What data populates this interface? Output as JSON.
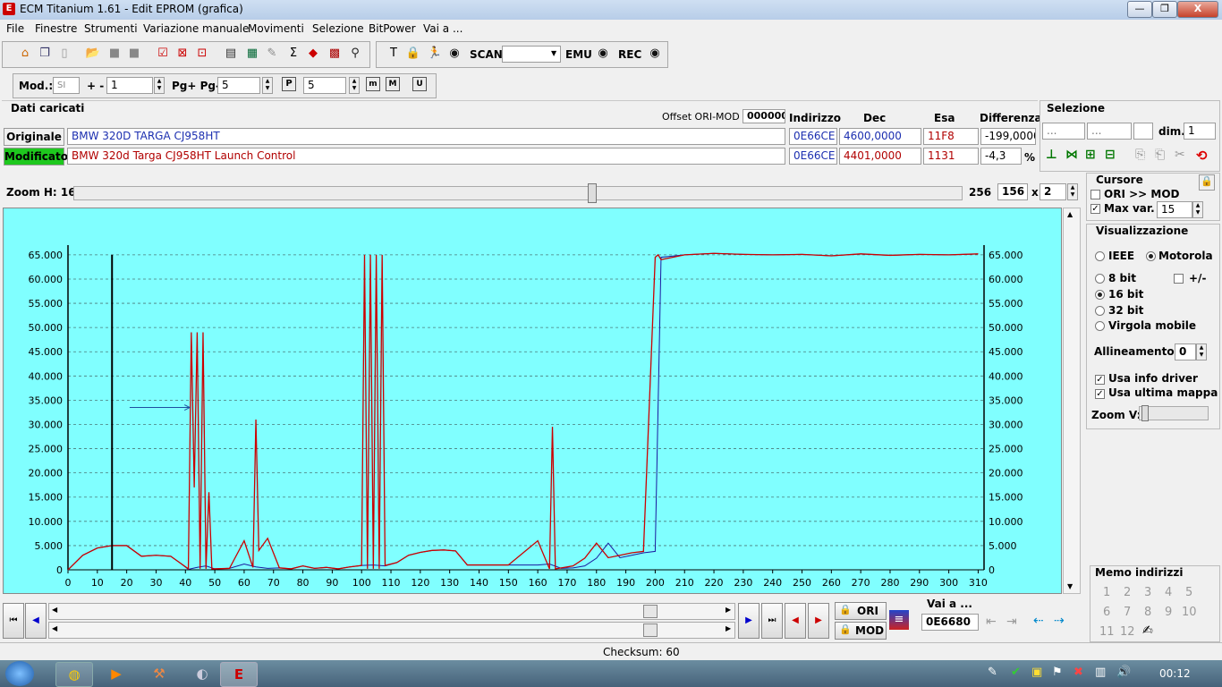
{
  "window": {
    "title": "ECM Titanium 1.61 - Edit EPROM (grafica)",
    "min": "—",
    "max": "❐",
    "close": "X"
  },
  "menu": [
    "File",
    "Finestre",
    "Strumenti",
    "Variazione manuale",
    "Movimenti",
    "Selezione",
    "BitPower",
    "Vai a ..."
  ],
  "toolbar": {
    "scan_label": "SCAN",
    "emu_label": "EMU",
    "rec_label": "REC"
  },
  "toolbar2": {
    "mod_label": "Mod.:",
    "mod_value": "SI",
    "step_label": "+ -",
    "step_value": "1",
    "pg_label": "Pg+ Pg-",
    "pg_value": "5",
    "p_value": "5"
  },
  "data": {
    "section_title": "Dati caricati",
    "offset_label": "Offset ORI-MOD",
    "offset_value": "000000",
    "col_indirizzo": "Indirizzo",
    "col_dec": "Dec",
    "col_esa": "Esa",
    "col_diff": "Differenza",
    "orig_label": "Originale",
    "orig_name": "BMW 320D TARGA CJ958HT",
    "orig_addr": "0E66CE",
    "orig_dec": "4600,0000",
    "orig_esa": "11F8",
    "orig_diff": "-199,0000",
    "mod_label": "Modificato",
    "mod_name": "BMW 320d Targa CJ958HT Launch Control",
    "mod_addr": "0E66CE",
    "mod_dec": "4401,0000",
    "mod_esa": "1131",
    "mod_diff": "-4,3",
    "pct": "%"
  },
  "selezione": {
    "title": "Selezione",
    "f1": "...",
    "f2": "...",
    "dim_label": "dim.",
    "dim_value": "1"
  },
  "zoom": {
    "label": "Zoom H: 16",
    "right": "256",
    "w": "156",
    "x": "x",
    "h": "2"
  },
  "cursore": {
    "title": "Cursore",
    "ori_mod": "ORI >> MOD",
    "max_var": "Max var.",
    "max_var_value": "15"
  },
  "visual": {
    "title": "Visualizzazione",
    "ieee": "IEEE",
    "motorola": "Motorola",
    "b8": "8 bit",
    "pm": "+/-",
    "b16": "16 bit",
    "b32": "32 bit",
    "float": "Virgola mobile",
    "align_label": "Allineamento:",
    "align_value": "0",
    "info_driver": "Usa info driver",
    "last_map": "Usa ultima mappa",
    "zoomv": "Zoom V:"
  },
  "memo": {
    "title": "Memo indirizzi",
    "nums": [
      "1",
      "2",
      "3",
      "4",
      "5",
      "6",
      "7",
      "8",
      "9",
      "10",
      "11",
      "12"
    ]
  },
  "bottom": {
    "ori": "ORI",
    "mod": "MOD",
    "vai_label": "Vai a ...",
    "vai_value": "0E6680",
    "checksum": "Checksum: 60"
  },
  "taskbar": {
    "time": "00:12"
  },
  "chart_data": {
    "type": "line",
    "xlim": [
      0,
      312
    ],
    "ylim": [
      0,
      65535
    ],
    "xticks": [
      0,
      10,
      20,
      30,
      40,
      50,
      60,
      70,
      80,
      90,
      100,
      110,
      120,
      130,
      140,
      150,
      160,
      170,
      180,
      190,
      200,
      210,
      220,
      230,
      240,
      250,
      260,
      270,
      280,
      290,
      300,
      310
    ],
    "yticks": [
      0,
      5000,
      10000,
      15000,
      20000,
      25000,
      30000,
      35000,
      40000,
      45000,
      50000,
      55000,
      60000,
      65000
    ],
    "ytick_labels": [
      "0",
      "5.000",
      "10.000",
      "15.000",
      "20.000",
      "25.000",
      "30.000",
      "35.000",
      "40.000",
      "45.000",
      "50.000",
      "55.000",
      "60.000",
      "65.000"
    ],
    "grid": "horizontal dashed",
    "cursor_x": 15,
    "series": [
      {
        "color": "#1a1aa0",
        "x": [
          0,
          5,
          10,
          15,
          20,
          25,
          30,
          35,
          38,
          41,
          44,
          47,
          50,
          55,
          60,
          64,
          68,
          72,
          76,
          80,
          84,
          88,
          92,
          96,
          100,
          104,
          108,
          112,
          116,
          120,
          124,
          128,
          132,
          136,
          140,
          150,
          160,
          164,
          168,
          172,
          176,
          180,
          184,
          188,
          192,
          196,
          200,
          202,
          210,
          220,
          230,
          240,
          250,
          260,
          270,
          280,
          290,
          300,
          310
        ],
        "y": [
          0,
          3000,
          4500,
          5000,
          5000,
          2800,
          3000,
          2800,
          1500,
          100,
          500,
          800,
          200,
          300,
          1200,
          600,
          300,
          400,
          200,
          800,
          300,
          500,
          200,
          600,
          900,
          1000,
          800,
          1500,
          3000,
          3600,
          4000,
          4100,
          3900,
          1000,
          1000,
          1000,
          1000,
          1200,
          300,
          400,
          800,
          2400,
          5500,
          2500,
          3000,
          3500,
          3800,
          64500,
          65000,
          65300,
          65100,
          65000,
          65100,
          64800,
          65200,
          64900,
          65100,
          65000,
          65200
        ]
      },
      {
        "color": "#cc0000",
        "x": [
          0,
          5,
          10,
          15,
          20,
          25,
          30,
          35,
          38,
          41,
          42,
          43,
          44,
          45,
          46,
          47,
          48,
          49,
          50,
          55,
          60,
          63,
          64,
          65,
          68,
          72,
          76,
          80,
          84,
          88,
          92,
          96,
          100,
          101,
          102,
          103,
          104,
          105,
          106,
          107,
          108,
          112,
          116,
          120,
          124,
          128,
          132,
          136,
          140,
          150,
          160,
          164,
          165,
          166,
          168,
          172,
          176,
          180,
          184,
          188,
          192,
          196,
          200,
          201,
          202,
          210,
          220,
          230,
          240,
          250,
          260,
          270,
          280,
          290,
          300,
          310
        ],
        "y": [
          0,
          3000,
          4500,
          5000,
          5000,
          2800,
          3000,
          2800,
          1500,
          200,
          49000,
          17000,
          49000,
          200,
          49000,
          200,
          16000,
          200,
          200,
          300,
          6000,
          500,
          31000,
          4000,
          6500,
          400,
          200,
          800,
          300,
          500,
          200,
          600,
          900,
          65000,
          200,
          65000,
          200,
          65000,
          200,
          65000,
          900,
          1500,
          3000,
          3600,
          4000,
          4100,
          3900,
          1000,
          1000,
          1000,
          6000,
          200,
          29500,
          200,
          400,
          800,
          2400,
          5500,
          2500,
          3000,
          3500,
          3800,
          64500,
          65000,
          64000,
          65000,
          65300,
          65100,
          65000,
          65100,
          64800,
          65200,
          64900,
          65100,
          65000,
          65200
        ]
      }
    ]
  }
}
